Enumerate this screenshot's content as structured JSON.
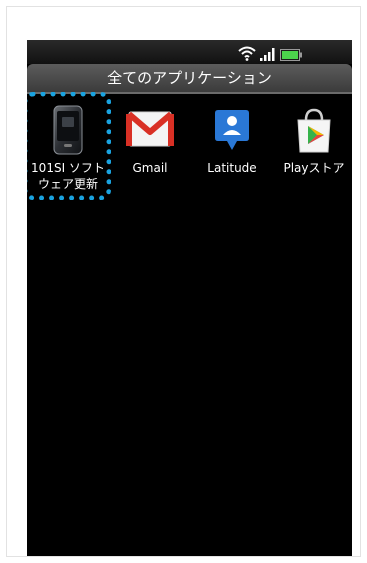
{
  "header": {
    "title": "全てのアプリケーション"
  },
  "status_icons": [
    "wifi-icon",
    "signal-icon",
    "battery-icon"
  ],
  "apps": [
    {
      "label_line1": "101SI ソフト",
      "label_line2": "ウェア更新",
      "icon": "phone-device-icon"
    },
    {
      "label_line1": "Gmail",
      "label_line2": "",
      "icon": "gmail-icon"
    },
    {
      "label_line1": "Latitude",
      "label_line2": "",
      "icon": "latitude-icon"
    },
    {
      "label_line1": "Playストア",
      "label_line2": "",
      "icon": "play-store-icon"
    }
  ],
  "colors": {
    "highlight": "#1aa3e0",
    "battery": "#4cd34c",
    "gmail_red": "#d93025",
    "latitude_blue": "#2a78d6"
  }
}
